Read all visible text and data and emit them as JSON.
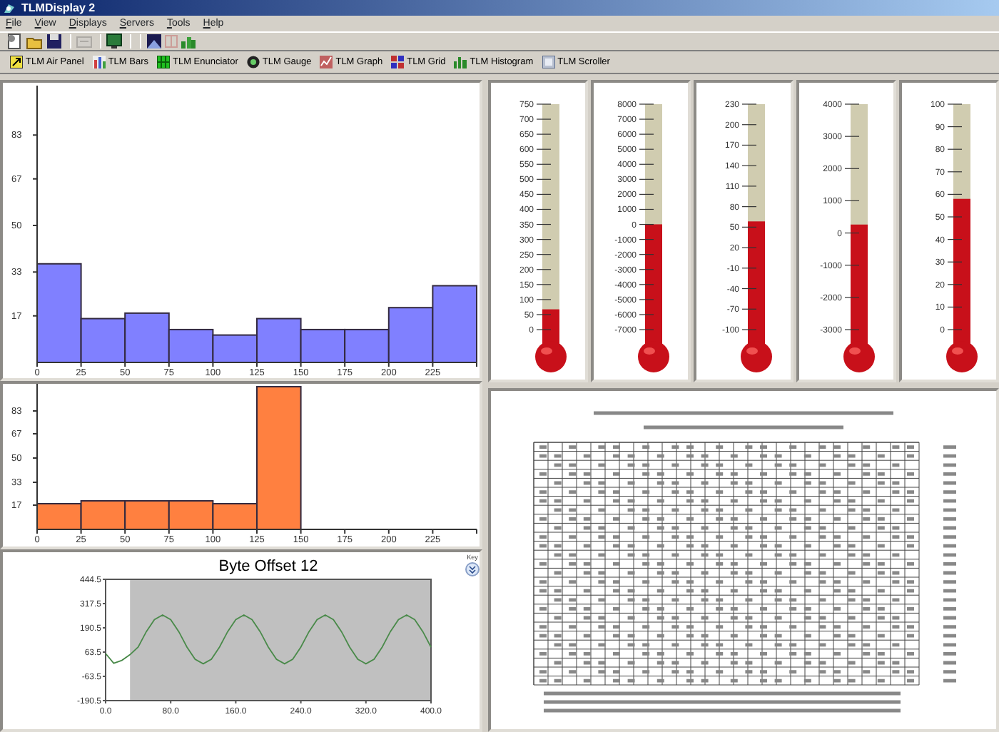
{
  "window": {
    "title": "TLMDisplay 2"
  },
  "menu": [
    "File",
    "View",
    "Displays",
    "Servers",
    "Tools",
    "Help"
  ],
  "toolbar": {
    "groups": [
      [
        {
          "disabled": false
        },
        {
          "disabled": false
        },
        {
          "disabled": false
        }
      ],
      [
        {
          "disabled": true
        }
      ],
      [
        {
          "disabled": false
        }
      ],
      [
        {
          "disabled": false
        },
        {
          "disabled": true
        },
        {
          "disabled": false
        }
      ]
    ]
  },
  "display_toolbar": [
    "TLM Air Panel",
    "TLM Bars",
    "TLM Enunciator",
    "TLM Gauge",
    "TLM Graph",
    "TLM Grid",
    "TLM Histogram",
    "TLM Scroller"
  ],
  "histograms": [
    {
      "chart_data": {
        "type": "bar",
        "x": [
          12.5,
          37.5,
          62.5,
          87.5,
          112.5,
          137.5,
          162.5,
          187.5,
          212.5,
          237.5
        ],
        "series": [
          {
            "color": "#8080ff",
            "values": [
              36,
              16,
              18,
              12,
              10,
              16,
              12,
              12,
              20,
              28
            ]
          }
        ],
        "xlim": [
          0,
          250
        ],
        "ylim": [
          0,
          100
        ],
        "xticks": [
          0,
          25,
          50,
          75,
          100,
          125,
          150,
          175,
          200,
          225
        ],
        "yticks": [
          17,
          33,
          50,
          67,
          83
        ]
      }
    },
    {
      "chart_data": {
        "type": "bar",
        "x": [
          12.5,
          37.5,
          62.5,
          87.5,
          112.5,
          137.5,
          162.5,
          187.5,
          212.5,
          237.5
        ],
        "series": [
          {
            "color": "#ff8040",
            "values": [
              18,
              20,
              20,
              20,
              18,
              100,
              0,
              0,
              0,
              0
            ]
          }
        ],
        "xlim": [
          0,
          250
        ],
        "ylim": [
          0,
          100
        ],
        "xticks": [
          0,
          25,
          50,
          75,
          100,
          125,
          150,
          175,
          200,
          225
        ],
        "yticks": [
          17,
          33,
          50,
          67,
          83
        ]
      }
    }
  ],
  "graph": {
    "title": "Byte Offset 12",
    "key_label": "Key",
    "chart_data": {
      "type": "line",
      "x": [
        0,
        10,
        20,
        30,
        40,
        50,
        60,
        70,
        80,
        90,
        100,
        110,
        120,
        130,
        140,
        150,
        160,
        170,
        180,
        190,
        200,
        210,
        220,
        230,
        240,
        250,
        260,
        270,
        280,
        290,
        300,
        310,
        320,
        330,
        340,
        350,
        360,
        370,
        380,
        390,
        400
      ],
      "series": [
        {
          "color": "#4a8a4a",
          "values": [
            56,
            5,
            20,
            50,
            90,
            170,
            234,
            258,
            234,
            170,
            90,
            26,
            2,
            26,
            90,
            170,
            234,
            258,
            234,
            170,
            90,
            26,
            2,
            26,
            90,
            170,
            234,
            258,
            234,
            170,
            90,
            26,
            2,
            26,
            90,
            170,
            234,
            258,
            234,
            170,
            90
          ]
        }
      ],
      "xlim": [
        0,
        400
      ],
      "ylim": [
        -190.5,
        444.5
      ],
      "xticks": [
        {
          "value": 0,
          "label": "0.0"
        },
        {
          "value": 80,
          "label": "80.0"
        },
        {
          "value": 160,
          "label": "160.0"
        },
        {
          "value": 240,
          "label": "240.0"
        },
        {
          "value": 320,
          "label": "320.0"
        },
        {
          "value": 400,
          "label": "400.0"
        }
      ],
      "yticks": [
        {
          "value": 444.5,
          "label": "444.5"
        },
        {
          "value": 317.5,
          "label": "317.5"
        },
        {
          "value": 190.5,
          "label": "190.5"
        },
        {
          "value": 63.5,
          "label": "63.5"
        },
        {
          "value": -63.5,
          "label": "-63.5"
        },
        {
          "value": -190.5,
          "label": "-190.5"
        }
      ],
      "bands": [
        {
          "axis": "x",
          "from": 30,
          "to": 400,
          "color": "#c0c0c0"
        }
      ]
    }
  },
  "thermometers": [
    {
      "ticks": [
        "750",
        "700",
        "650",
        "600",
        "550",
        "500",
        "450",
        "400",
        "350",
        "300",
        "250",
        "200",
        "150",
        "100",
        "50",
        "0"
      ],
      "level": 0.09
    },
    {
      "ticks": [
        "8000",
        "7000",
        "6000",
        "5000",
        "4000",
        "3000",
        "2000",
        "1000",
        "0",
        "-1000",
        "-2000",
        "-3000",
        "-4000",
        "-5000",
        "-6000",
        "-7000"
      ],
      "level": 0.467
    },
    {
      "ticks": [
        "230",
        "200",
        "170",
        "140",
        "110",
        "80",
        "50",
        "20",
        "-10",
        "-40",
        "-70",
        "-100"
      ],
      "level": 0.48
    },
    {
      "ticks": [
        "4000",
        "3000",
        "2000",
        "1000",
        "0",
        "-1000",
        "-2000",
        "-3000"
      ],
      "level": 0.466
    },
    {
      "ticks": [
        "100",
        "90",
        "80",
        "70",
        "60",
        "50",
        "40",
        "30",
        "20",
        "10",
        "0"
      ],
      "level": 0.58
    }
  ]
}
